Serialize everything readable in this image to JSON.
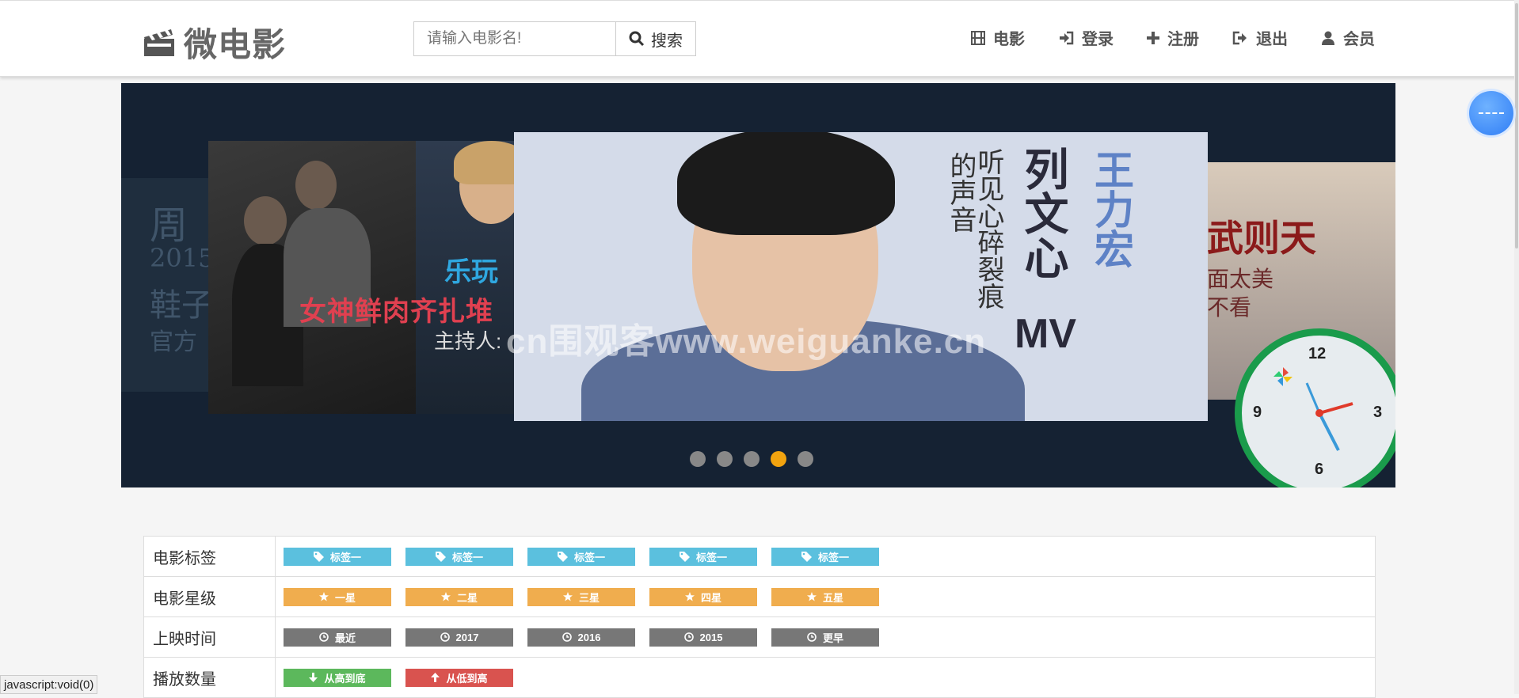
{
  "header": {
    "logo_text": "微电影",
    "search": {
      "placeholder": "请输入电影名!",
      "button_label": "搜索"
    },
    "nav": [
      {
        "label": "电影",
        "icon": "film-icon"
      },
      {
        "label": "登录",
        "icon": "login-icon"
      },
      {
        "label": "注册",
        "icon": "plus-icon"
      },
      {
        "label": "退出",
        "icon": "logout-icon"
      },
      {
        "label": "会员",
        "icon": "user-icon"
      }
    ]
  },
  "carousel": {
    "left_slide": {
      "lines": [
        "周",
        "2015",
        "鞋子",
        "官方"
      ]
    },
    "second_slide": {
      "title": "女神鲜肉齐扎堆",
      "tag": "乐玩",
      "host": "主持人:"
    },
    "main_slide": {
      "col1": "王力宏",
      "col2": "列文心",
      "mv": "MV",
      "col3": "听见心碎裂痕",
      "col4": "的声音"
    },
    "right_slide": {
      "title": "武则天",
      "line1": "面太美",
      "line2": "不看"
    },
    "watermark": "cn围观客www.weiguanke.cn",
    "indicators": {
      "count": 5,
      "active_index": 3
    },
    "clock": {
      "numbers": [
        "12",
        "3",
        "6",
        "9"
      ]
    }
  },
  "filters": {
    "rows": [
      {
        "label": "电影标签",
        "buttons": [
          "标签一",
          "标签一",
          "标签一",
          "标签一",
          "标签一"
        ]
      },
      {
        "label": "电影星级",
        "buttons": [
          "一星",
          "二星",
          "三星",
          "四星",
          "五星"
        ]
      },
      {
        "label": "上映时间",
        "buttons": [
          "最近",
          "2017",
          "2016",
          "2015",
          "更早"
        ]
      },
      {
        "label": "播放数量",
        "buttons": [
          "从高到底",
          "从低到高"
        ]
      }
    ]
  },
  "statusbar": {
    "text": "javascript:void(0)"
  },
  "colors": {
    "info": "#5bc0de",
    "warning": "#f0ad4e",
    "gray": "#777777",
    "success": "#5cb85c",
    "danger": "#d9534f",
    "indicator_active": "#f2a30f"
  }
}
